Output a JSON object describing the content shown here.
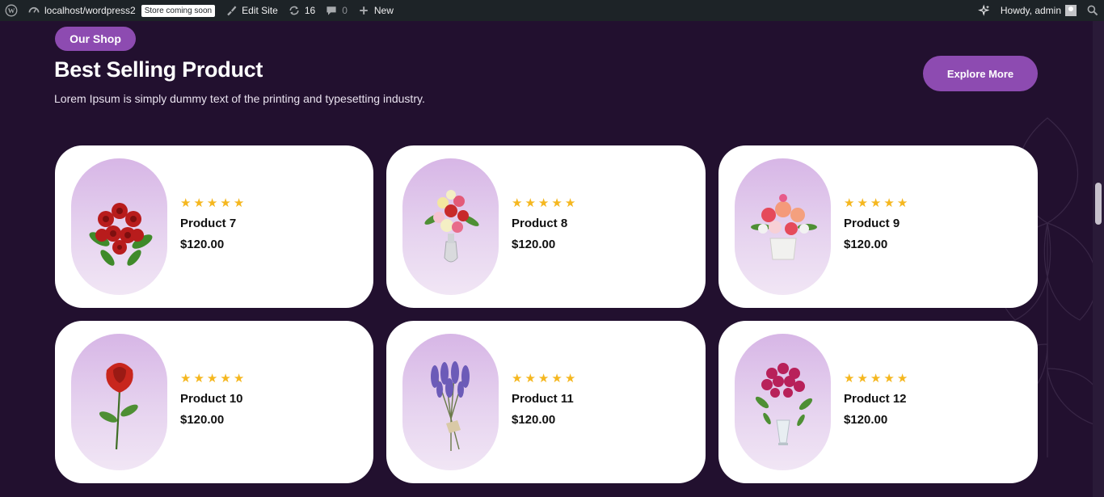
{
  "adminbar": {
    "site": "localhost/wordpress2",
    "store_badge": "Store coming soon",
    "edit_site": "Edit Site",
    "updates_count": "16",
    "comments_count": "0",
    "new_label": "New",
    "howdy": "Howdy, admin"
  },
  "hero": {
    "chip": "Our Shop",
    "title": "Best Selling Product",
    "subtitle": "Lorem Ipsum is simply dummy text of the printing and typesetting industry.",
    "explore_label": "Explore More"
  },
  "products": [
    {
      "name": "Product 7",
      "price": "$120.00",
      "rating": 5,
      "image": "red-roses-bouquet"
    },
    {
      "name": "Product 8",
      "price": "$120.00",
      "rating": 5,
      "image": "mixed-flowers-vase"
    },
    {
      "name": "Product 9",
      "price": "$120.00",
      "rating": 5,
      "image": "pink-bouquet-pot"
    },
    {
      "name": "Product 10",
      "price": "$120.00",
      "rating": 5,
      "image": "single-red-rose"
    },
    {
      "name": "Product 11",
      "price": "$120.00",
      "rating": 5,
      "image": "lavender-bunch"
    },
    {
      "name": "Product 12",
      "price": "$120.00",
      "rating": 5,
      "image": "pink-roses-glass-vase"
    }
  ],
  "colors": {
    "accent": "#8d4bb1",
    "background": "#22102f",
    "star": "#f5b71f"
  }
}
